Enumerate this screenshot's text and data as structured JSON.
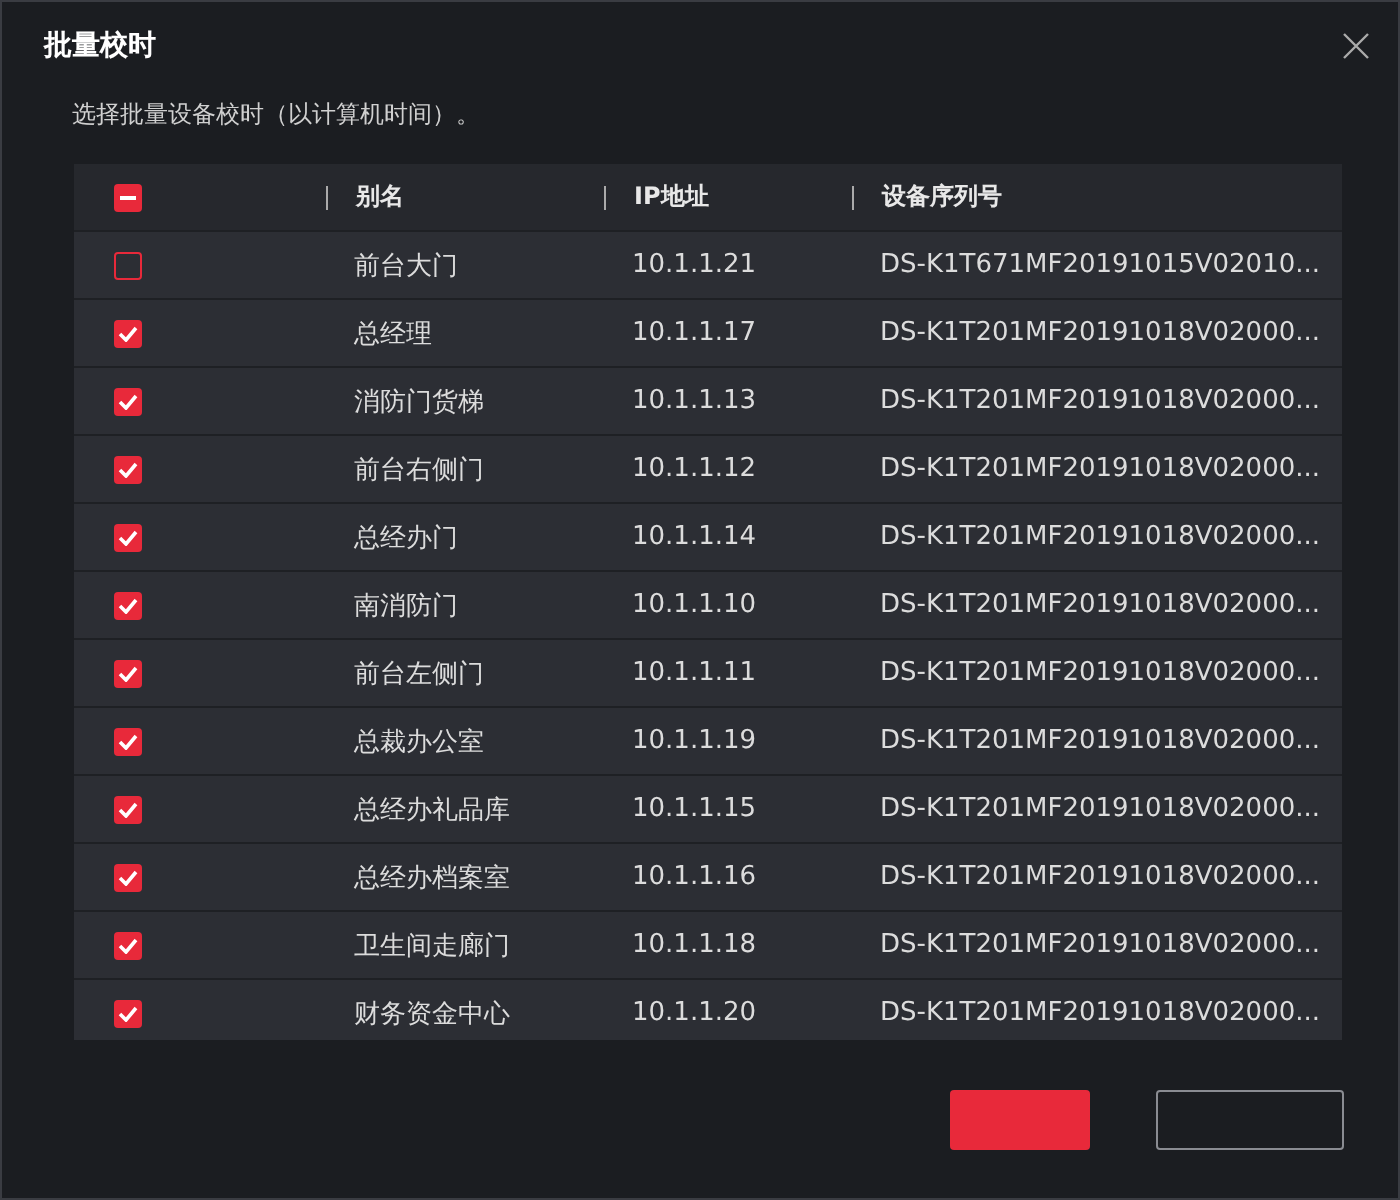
{
  "dialog": {
    "title": "批量校时",
    "hint": "选择批量设备校时（以计算机时间）。"
  },
  "table": {
    "select_all": {
      "indeterminate": true
    },
    "columns": [
      "别名",
      "IP地址",
      "设备序列号"
    ],
    "rows": [
      {
        "checked": false,
        "name": "前台大门",
        "ip": "10.1.1.21",
        "serial": "DS-K1T671MF20191015V02010..."
      },
      {
        "checked": true,
        "name": "总经理",
        "ip": "10.1.1.17",
        "serial": "DS-K1T201MF20191018V02000..."
      },
      {
        "checked": true,
        "name": "消防门货梯",
        "ip": "10.1.1.13",
        "serial": "DS-K1T201MF20191018V02000..."
      },
      {
        "checked": true,
        "name": "前台右侧门",
        "ip": "10.1.1.12",
        "serial": "DS-K1T201MF20191018V02000..."
      },
      {
        "checked": true,
        "name": "总经办门",
        "ip": "10.1.1.14",
        "serial": "DS-K1T201MF20191018V02000..."
      },
      {
        "checked": true,
        "name": "南消防门",
        "ip": "10.1.1.10",
        "serial": "DS-K1T201MF20191018V02000..."
      },
      {
        "checked": true,
        "name": "前台左侧门",
        "ip": "10.1.1.11",
        "serial": "DS-K1T201MF20191018V02000..."
      },
      {
        "checked": true,
        "name": "总裁办公室",
        "ip": "10.1.1.19",
        "serial": "DS-K1T201MF20191018V02000..."
      },
      {
        "checked": true,
        "name": "总经办礼品库",
        "ip": "10.1.1.15",
        "serial": "DS-K1T201MF20191018V02000..."
      },
      {
        "checked": true,
        "name": "总经办档案室",
        "ip": "10.1.1.16",
        "serial": "DS-K1T201MF20191018V02000..."
      },
      {
        "checked": true,
        "name": "卫生间走廊门",
        "ip": "10.1.1.18",
        "serial": "DS-K1T201MF20191018V02000..."
      },
      {
        "checked": true,
        "name": "财务资金中心",
        "ip": "10.1.1.20",
        "serial": "DS-K1T201MF20191018V02000..."
      }
    ]
  },
  "buttons": [
    {
      "kind": "primary"
    },
    {
      "kind": "secondary"
    }
  ]
}
